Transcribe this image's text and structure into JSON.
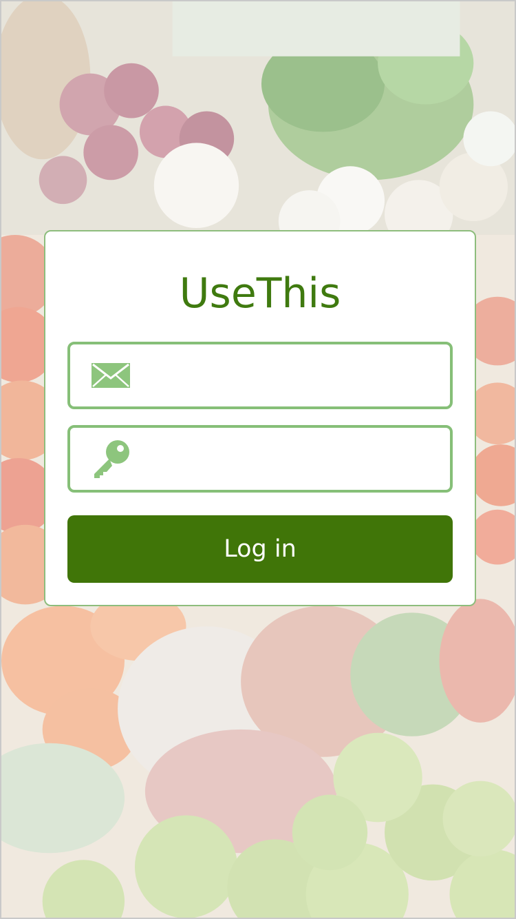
{
  "app": {
    "title": "UseThis"
  },
  "login_form": {
    "email": {
      "icon": "envelope-icon",
      "value": "",
      "placeholder": ""
    },
    "password": {
      "icon": "key-icon",
      "value": "",
      "placeholder": ""
    },
    "submit_label": "Log in"
  },
  "colors": {
    "brand_green": "#3f7a0f",
    "button_green": "#407508",
    "field_border": "#86bf78",
    "icon_green": "#8dc57d"
  },
  "background": {
    "description_icon": "vegetable-market-photo"
  }
}
